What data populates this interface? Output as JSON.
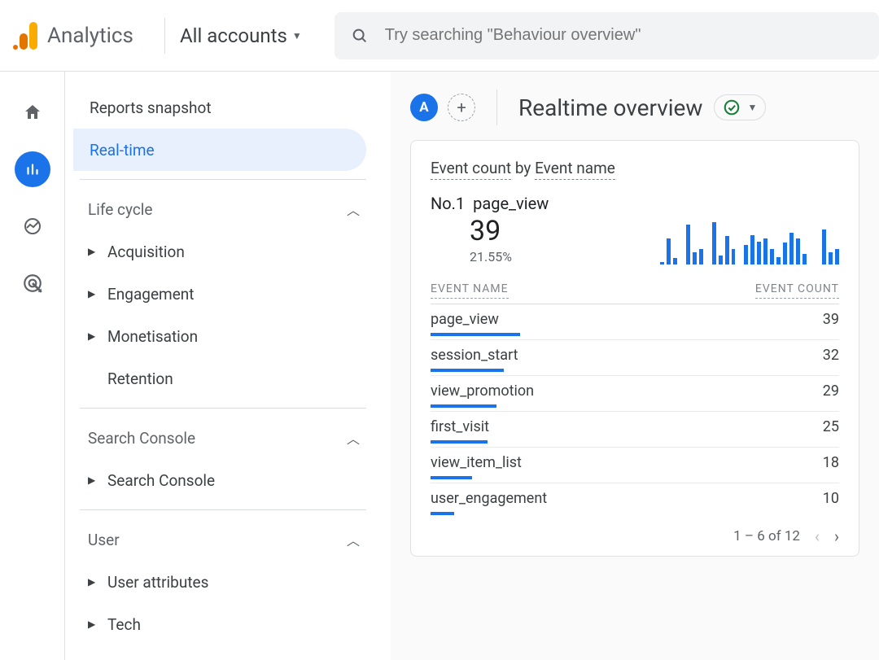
{
  "header": {
    "app_name": "Analytics",
    "account_switcher": "All accounts",
    "search_placeholder": "Try searching \"Behaviour overview\""
  },
  "reports_nav": {
    "snapshot": "Reports snapshot",
    "realtime": "Real-time",
    "section_lifecycle": "Life cycle",
    "acquisition": "Acquisition",
    "engagement": "Engagement",
    "monetisation": "Monetisation",
    "retention": "Retention",
    "section_searchconsole": "Search Console",
    "searchconsole": "Search Console",
    "section_user": "User",
    "user_attributes": "User attributes",
    "tech": "Tech"
  },
  "page": {
    "badge": "A",
    "title": "Realtime overview"
  },
  "card": {
    "title_metric": "Event count",
    "title_by": "by",
    "title_dim": "Event name",
    "top_rank": "No.1",
    "top_name": "page_view",
    "top_value": "39",
    "top_pct": "21.55%",
    "col_name": "EVENT NAME",
    "col_count": "EVENT COUNT",
    "rows": [
      {
        "name": "page_view",
        "count": "39",
        "bar_pct": 100
      },
      {
        "name": "session_start",
        "count": "32",
        "bar_pct": 82
      },
      {
        "name": "view_promotion",
        "count": "29",
        "bar_pct": 74
      },
      {
        "name": "first_visit",
        "count": "25",
        "bar_pct": 64
      },
      {
        "name": "view_item_list",
        "count": "18",
        "bar_pct": 46
      },
      {
        "name": "user_engagement",
        "count": "10",
        "bar_pct": 26
      }
    ],
    "pager_text": "1 – 6 of 12"
  },
  "chart_data": {
    "type": "bar",
    "title": "page_view event count over realtime window (sparkline)",
    "xlabel": "",
    "ylabel": "",
    "values": [
      0,
      0,
      0,
      0,
      0,
      3,
      30,
      7,
      0,
      45,
      14,
      18,
      0,
      48,
      10,
      32,
      18,
      0,
      22,
      33,
      26,
      30,
      18,
      8,
      25,
      36,
      30,
      12,
      0,
      0,
      40,
      14,
      18
    ]
  }
}
